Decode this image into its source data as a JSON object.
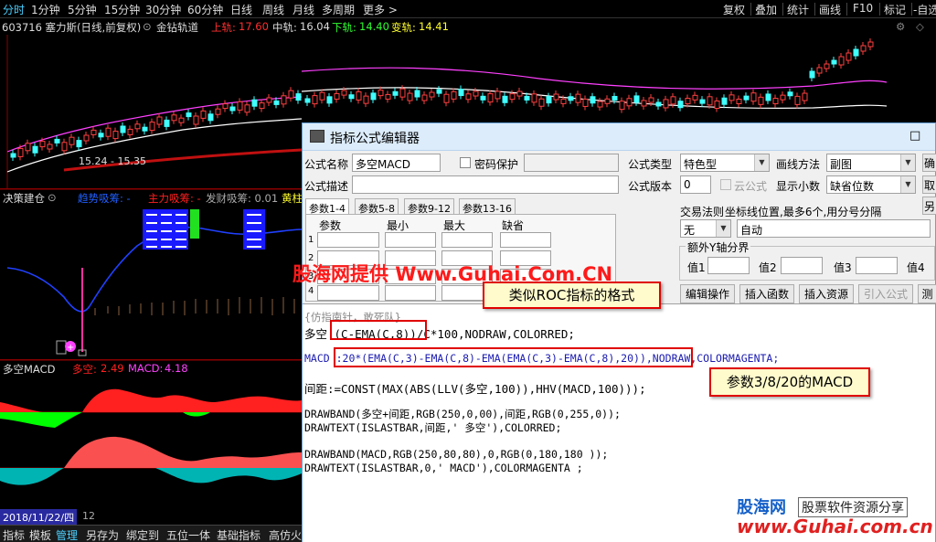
{
  "toolbar": {
    "left": [
      "分时",
      "1分钟",
      "5分钟",
      "15分钟",
      "30分钟",
      "60分钟",
      "日线",
      "周线",
      "月线",
      "多周期",
      "更多 >"
    ],
    "right": [
      "复权",
      "叠加",
      "统计",
      "画线",
      "F10",
      "标记",
      "-自选"
    ]
  },
  "info": {
    "stock": "603716 塞力斯(日线,前复权)",
    "indicator": "金钻轨道",
    "upper_label": "上轨:",
    "upper_value": "17.60",
    "mid_label": "中轨:",
    "mid_value": "16.04",
    "lower_label": "下轨:",
    "lower_value": "14.40",
    "var_label": "变轨:",
    "var_value": "14.41"
  },
  "price_panel": {
    "range_label": "15.24 - 15.35"
  },
  "decision_panel": {
    "title": "决策建仓",
    "trend": "趋势吸筹: -",
    "main": "主力吸筹: -",
    "fortune": "发财吸筹: 0.01",
    "extra": "黄柱"
  },
  "macd_panel": {
    "title": "多空MACD",
    "dk_label": "多空:",
    "dk_value": "2.49",
    "macd_label": "MACD:",
    "macd_value": "4.18"
  },
  "date_bar": {
    "date": "2018/11/22/四",
    "extra": "12"
  },
  "bottom_tabs": [
    "指标",
    "模板",
    "管理",
    "另存为",
    "绑定到",
    "五位一体",
    "基础指标",
    "高仿火"
  ],
  "dialog": {
    "title": "指标公式编辑器",
    "name_label": "公式名称",
    "name_value": "多空MACD",
    "password_label": "密码保护",
    "desc_label": "公式描述",
    "type_label": "公式类型",
    "type_value": "特色型",
    "draw_label": "画线方法",
    "draw_value": "副图",
    "version_label": "公式版本",
    "version_value": "0",
    "cloud_label": "云公式",
    "decimal_label": "显示小数",
    "decimal_value": "缺省位数",
    "tabs": [
      "参数1-4",
      "参数5-8",
      "参数9-12",
      "参数13-16"
    ],
    "param_headers": [
      "参数",
      "最小",
      "最大",
      "缺省"
    ],
    "param_rows": [
      "1",
      "2",
      "3",
      "4"
    ],
    "trade_label": "交易法则",
    "trade_value": "无",
    "axis_label": "坐标线位置,最多6个,用分号分隔",
    "axis_value": "自动",
    "extra_axis_label": "额外Y轴分界",
    "val_labels": [
      "值1",
      "值2",
      "值3",
      "值4"
    ],
    "buttons": [
      "编辑操作",
      "插入函数",
      "插入资源",
      "引入公式",
      "测"
    ],
    "right_btns": [
      "确",
      "取",
      "另"
    ],
    "comment": "{仿指南针，敢死队}",
    "code": [
      "多空:(C-EMA(C,8))/C*100,NODRAW,COLORRED;",
      "MACD :20*(EMA(C,3)-EMA(C,8)-EMA(EMA(C,3)-EMA(C,8),20)),NODRAW,COLORMAGENTA;",
      "间距:=CONST(MAX(ABS(LLV(多空,100)),HHV(MACD,100)));",
      "DRAWBAND(多空+间距,RGB(250,0,00),间距,RGB(0,255,0));",
      "DRAWTEXT(ISLASTBAR,间距,' 多空'),COLORRED;",
      "DRAWBAND(MACD,RGB(250,80,80),0,RGB(0,180,180 ));",
      "DRAWTEXT(ISLASTBAR,0,' MACD'),COLORMAGENTA ;"
    ]
  },
  "callouts": {
    "roc": "类似ROC指标的格式",
    "macd": "参数3/8/20的MACD"
  },
  "watermarks": {
    "main": "股海网提供 Www.Guhai.Com.CN",
    "logo": "股海网",
    "slogan": "股票软件资源分享",
    "url": "www.Guhai.com.cn"
  },
  "colors": {
    "upper": "#ff3030",
    "mid": "#ffffff",
    "lower": "#30ff30",
    "var": "#ffff30",
    "dk_red": "#ff2020",
    "macd_magenta": "#ff40ff",
    "band_green": "#00ff00",
    "band_teal": "#00b4b4"
  }
}
